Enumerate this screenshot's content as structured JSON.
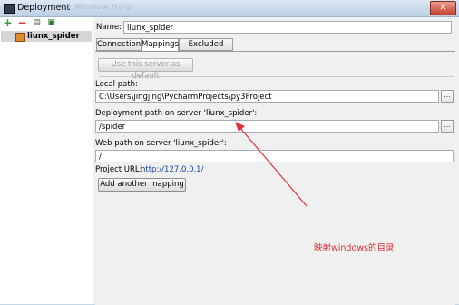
{
  "window": {
    "title": "Deployment",
    "background_menu": "VCS  Window  Help",
    "close_glyph": "✕"
  },
  "toolbar": {
    "add_icon": "+",
    "remove_icon": "−",
    "copy_icon": "▤",
    "default_icon": "▣"
  },
  "servers": [
    {
      "label": "liunx_spider",
      "selected": true
    }
  ],
  "form": {
    "name_label": "Name:",
    "name_value": "liunx_spider",
    "tabs": [
      {
        "label": "Connection"
      },
      {
        "label": "Mappings",
        "active": true
      },
      {
        "label": "Excluded Paths"
      }
    ],
    "use_default_button": "Use this server as default",
    "local_path_label": "Local path:",
    "local_path_value": "C:\\Users\\jingjing\\PycharmProjects\\py3Project",
    "deploy_path_label": "Deployment path on server 'liunx_spider':",
    "deploy_path_value": "/spider",
    "web_path_label": "Web path on server 'liunx_spider':",
    "web_path_value": "/",
    "project_url_label": "Project URL:",
    "project_url_value": "http://127.0.0.1/",
    "add_mapping_button": "Add another mapping",
    "browse_glyph": "..."
  },
  "annotation": {
    "text": "映射windows的目录",
    "color": "#e0303a"
  }
}
